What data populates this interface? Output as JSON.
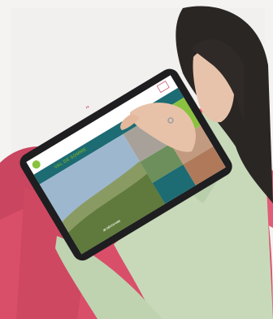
{
  "photo": {
    "subject": "woman holding a tablet showing a tourism website",
    "colors": {
      "sofa": "#d94f6a",
      "sweater": "#c7d9b9",
      "hair": "#2a2624",
      "tablet_frame": "#1e1e20",
      "site_teal": "#1d6b73",
      "site_green": "#8ac23f"
    }
  },
  "tablet_screen": {
    "logo_text": "VAL DE SOMME",
    "logo_subtitle": "",
    "language": "FR",
    "cta_label": "JE DÉCOUVRE"
  }
}
